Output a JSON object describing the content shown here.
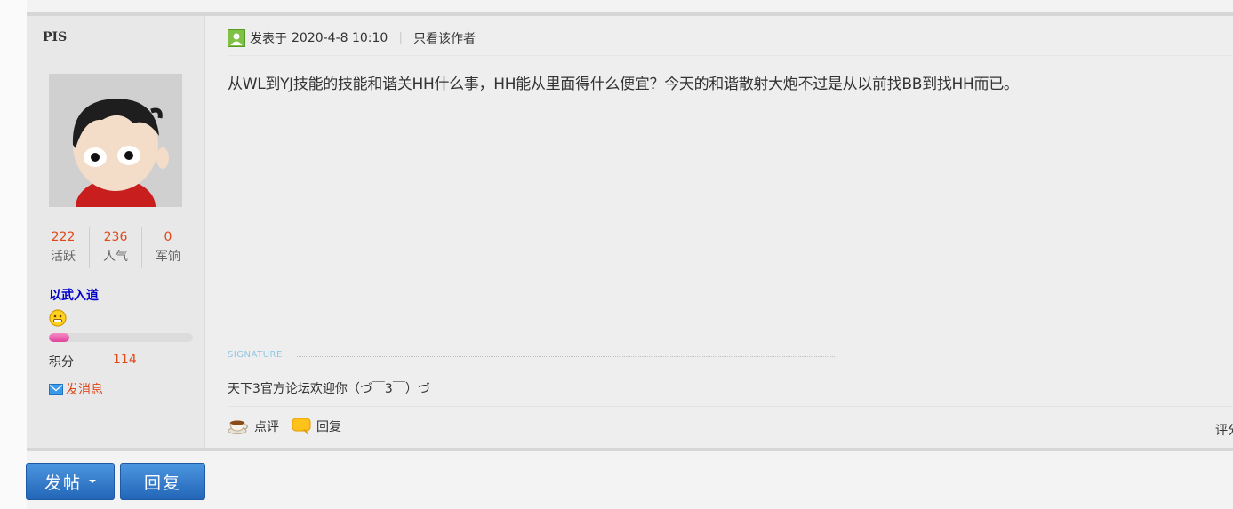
{
  "post": {
    "author": {
      "name": "PIS",
      "stats": [
        {
          "value": "222",
          "label": "活跃"
        },
        {
          "value": "236",
          "label": "人气"
        },
        {
          "value": "0",
          "label": "军饷"
        }
      ],
      "usergroup": "以武入道",
      "level_progress_percent": 14,
      "points_label": "积分",
      "points_value": "114",
      "send_message_label": "发消息"
    },
    "meta": {
      "posted_label": "发表于",
      "date": "2020-4-8 10:10",
      "separator": "|",
      "only_author_label": "只看该作者"
    },
    "body": "从WL到YJ技能的技能和谐关HH什么事，HH能从里面得什么便宜？今天的和谐散射大炮不过是从以前找BB到找HH而已。",
    "signature_label": "SIGNATURE",
    "signature_text": "天下3官方论坛欢迎你（づ￣3￣）づ",
    "actions": {
      "comment_label": "点评",
      "reply_label": "回复",
      "rate_label": "评分"
    }
  },
  "buttons": {
    "new_post_label": "发帖",
    "reply_label": "回复"
  },
  "colors": {
    "accent_red": "#e0481a",
    "usergroup_blue": "#0000cc",
    "button_blue": "#2466b8"
  }
}
